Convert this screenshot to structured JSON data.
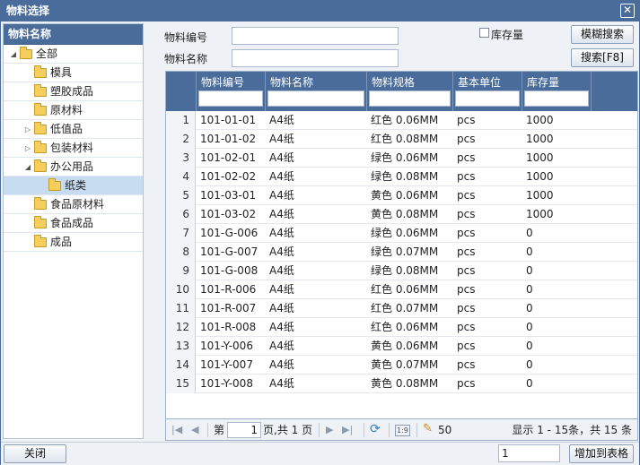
{
  "window": {
    "title": "物料选择",
    "close_glyph": "✕"
  },
  "tree": {
    "header": "物料名称",
    "items": [
      {
        "label": "全部",
        "toggle": "◢",
        "level": 0
      },
      {
        "label": "模具",
        "toggle": "",
        "level": 1
      },
      {
        "label": "塑胶成品",
        "toggle": "",
        "level": 1
      },
      {
        "label": "原材料",
        "toggle": "",
        "level": 1
      },
      {
        "label": "低值品",
        "toggle": "▷",
        "level": 1
      },
      {
        "label": "包装材料",
        "toggle": "▷",
        "level": 1
      },
      {
        "label": "办公用品",
        "toggle": "◢",
        "level": 1
      },
      {
        "label": "纸类",
        "toggle": "",
        "level": 2,
        "selected": true
      },
      {
        "label": "食品原材料",
        "toggle": "",
        "level": 1
      },
      {
        "label": "食品成品",
        "toggle": "",
        "level": 1
      },
      {
        "label": "成品",
        "toggle": "",
        "level": 1
      }
    ]
  },
  "filters": {
    "code_label": "物料编号",
    "code_value": "",
    "name_label": "物料名称",
    "name_value": "",
    "stock_label": "库存量",
    "stock_checked": false,
    "fuzzy_search": "模糊搜索",
    "search": "搜索[F8]"
  },
  "grid": {
    "columns": [
      "物料编号",
      "物料名称",
      "物料规格",
      "基本单位",
      "库存量"
    ],
    "rows": [
      {
        "num": "1",
        "code": "101-01-01",
        "name": "A4纸",
        "spec": "红色 0.06MM",
        "unit": "pcs",
        "stock": "1000"
      },
      {
        "num": "2",
        "code": "101-01-02",
        "name": "A4纸",
        "spec": "红色 0.08MM",
        "unit": "pcs",
        "stock": "1000"
      },
      {
        "num": "3",
        "code": "101-02-01",
        "name": "A4纸",
        "spec": "绿色 0.06MM",
        "unit": "pcs",
        "stock": "1000"
      },
      {
        "num": "4",
        "code": "101-02-02",
        "name": "A4纸",
        "spec": "绿色 0.08MM",
        "unit": "pcs",
        "stock": "1000"
      },
      {
        "num": "5",
        "code": "101-03-01",
        "name": "A4纸",
        "spec": "黄色 0.06MM",
        "unit": "pcs",
        "stock": "1000"
      },
      {
        "num": "6",
        "code": "101-03-02",
        "name": "A4纸",
        "spec": "黄色 0.08MM",
        "unit": "pcs",
        "stock": "1000"
      },
      {
        "num": "7",
        "code": "101-G-006",
        "name": "A4纸",
        "spec": "绿色 0.06MM",
        "unit": "pcs",
        "stock": "0"
      },
      {
        "num": "8",
        "code": "101-G-007",
        "name": "A4纸",
        "spec": "绿色 0.07MM",
        "unit": "pcs",
        "stock": "0"
      },
      {
        "num": "9",
        "code": "101-G-008",
        "name": "A4纸",
        "spec": "绿色 0.08MM",
        "unit": "pcs",
        "stock": "0"
      },
      {
        "num": "10",
        "code": "101-R-006",
        "name": "A4纸",
        "spec": "红色 0.06MM",
        "unit": "pcs",
        "stock": "0"
      },
      {
        "num": "11",
        "code": "101-R-007",
        "name": "A4纸",
        "spec": "红色 0.07MM",
        "unit": "pcs",
        "stock": "0"
      },
      {
        "num": "12",
        "code": "101-R-008",
        "name": "A4纸",
        "spec": "红色 0.06MM",
        "unit": "pcs",
        "stock": "0"
      },
      {
        "num": "13",
        "code": "101-Y-006",
        "name": "A4纸",
        "spec": "黄色 0.06MM",
        "unit": "pcs",
        "stock": "0"
      },
      {
        "num": "14",
        "code": "101-Y-007",
        "name": "A4纸",
        "spec": "黄色 0.07MM",
        "unit": "pcs",
        "stock": "0"
      },
      {
        "num": "15",
        "code": "101-Y-008",
        "name": "A4纸",
        "spec": "黄色 0.08MM",
        "unit": "pcs",
        "stock": "0"
      }
    ]
  },
  "pager": {
    "first_icon": "|◀",
    "prev_icon": "◀",
    "page_prefix": "第",
    "page_value": "1",
    "page_suffix": "页,共 1 页",
    "next_icon": "▶",
    "last_icon": "▶|",
    "refresh_icon": "⟳",
    "page_size_icon": "1:9",
    "pen_icon": "✎",
    "page_size": "50",
    "summary": "显示 1 - 15条，共 15 条"
  },
  "footer": {
    "close": "关闭",
    "quantity_value": "1",
    "add_to_table": "增加到表格"
  },
  "colors": {
    "header": "#4a6c9b",
    "selected": "#c7dcf0",
    "folder": "#f5cf5e"
  }
}
